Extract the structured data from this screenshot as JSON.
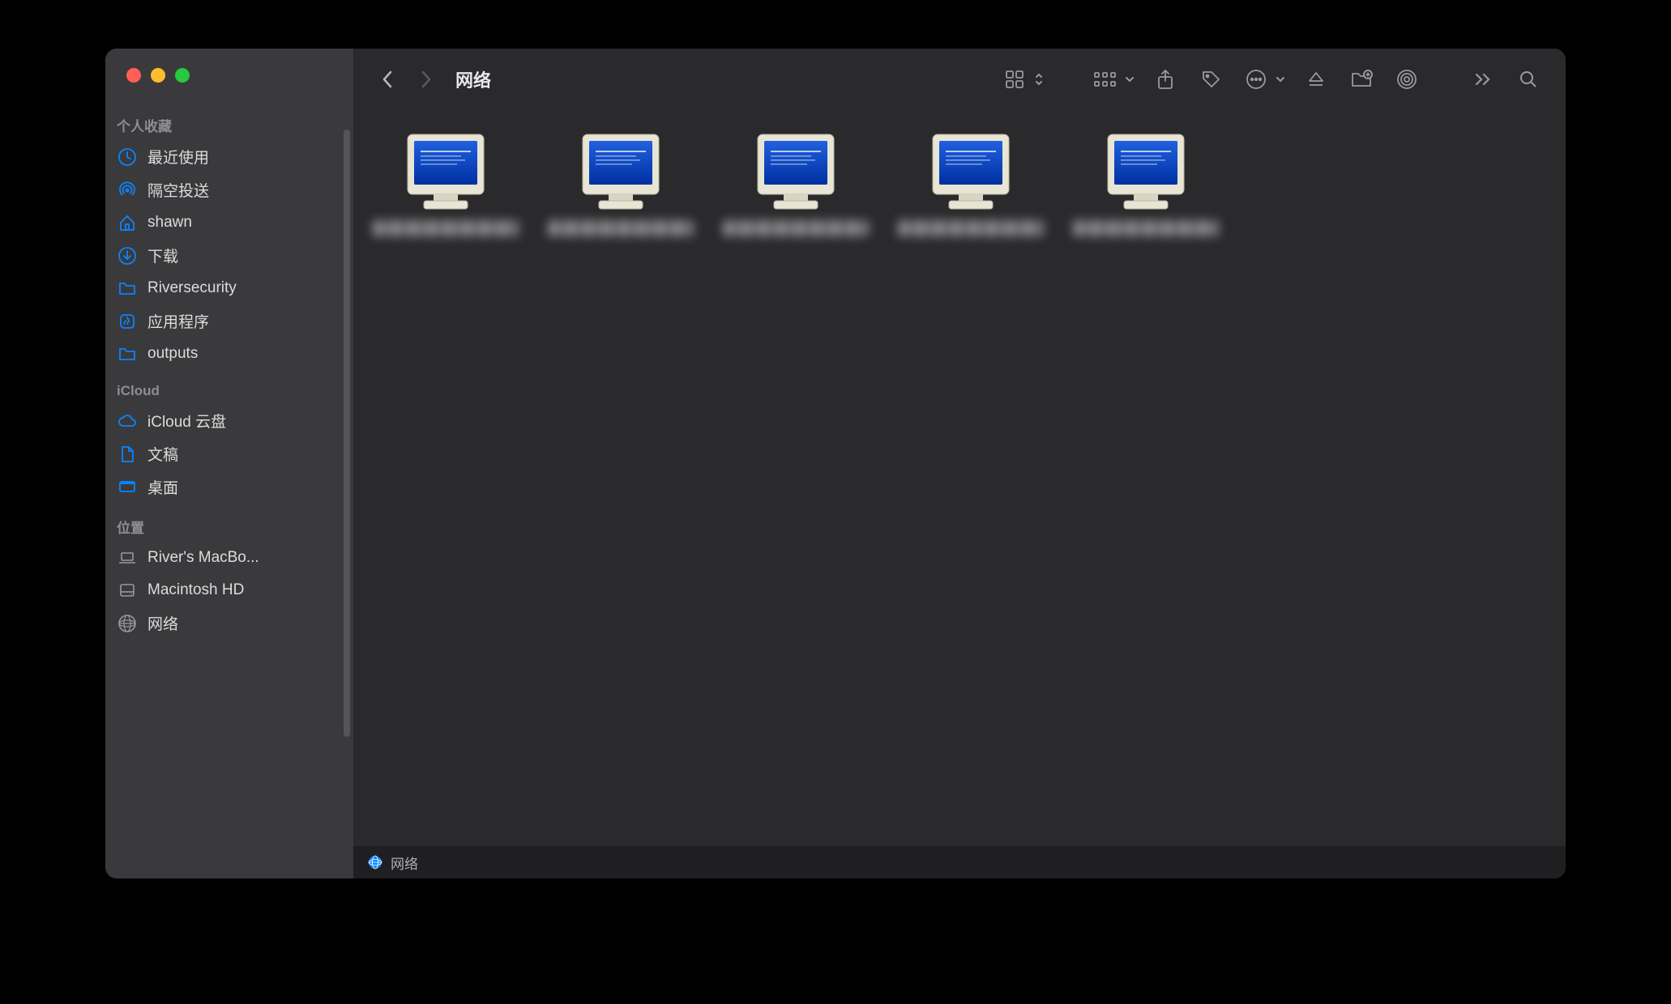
{
  "window": {
    "title": "网络"
  },
  "sidebar": {
    "sections": [
      {
        "title": "个人收藏",
        "items": [
          {
            "label": "最近使用",
            "icon": "clock"
          },
          {
            "label": "隔空投送",
            "icon": "airdrop"
          },
          {
            "label": "shawn",
            "icon": "house"
          },
          {
            "label": "下载",
            "icon": "download"
          },
          {
            "label": "Riversecurity",
            "icon": "folder"
          },
          {
            "label": "应用程序",
            "icon": "app"
          },
          {
            "label": "outputs",
            "icon": "folder"
          }
        ]
      },
      {
        "title": "iCloud",
        "items": [
          {
            "label": "iCloud 云盘",
            "icon": "cloud"
          },
          {
            "label": "文稿",
            "icon": "document"
          },
          {
            "label": "桌面",
            "icon": "desktop"
          }
        ]
      },
      {
        "title": "位置",
        "items": [
          {
            "label": "River's MacBo...",
            "icon": "laptop",
            "gray": true
          },
          {
            "label": "Macintosh HD",
            "icon": "disk",
            "gray": true
          },
          {
            "label": "网络",
            "icon": "globe",
            "gray": true
          }
        ]
      }
    ]
  },
  "toolbar": {
    "back_enabled": true,
    "forward_enabled": false
  },
  "items": [
    {
      "name": "████████"
    },
    {
      "name": "████████"
    },
    {
      "name": "████████"
    },
    {
      "name": "████████"
    },
    {
      "name": "████████"
    }
  ],
  "statusbar": {
    "path": "网络"
  }
}
